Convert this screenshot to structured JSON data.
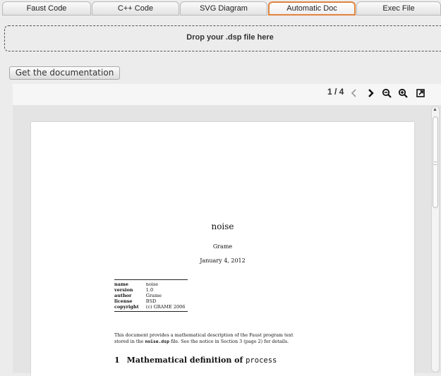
{
  "tabs": [
    {
      "label": "Faust Code",
      "active": false
    },
    {
      "label": "C++ Code",
      "active": false
    },
    {
      "label": "SVG Diagram",
      "active": false
    },
    {
      "label": "Automatic Doc",
      "active": true
    },
    {
      "label": "Exec File",
      "active": false
    }
  ],
  "dropzone": {
    "text": "Drop your .dsp file here"
  },
  "get_doc_button": "Get the documentation",
  "viewer": {
    "page_indicator": "1 / 4",
    "tools": {
      "prev": "chevron-left-icon",
      "next": "chevron-right-icon",
      "zoom_out": "zoom-out-icon",
      "zoom_in": "zoom-in-icon",
      "open": "external-open-icon"
    }
  },
  "document": {
    "title": "noise",
    "author": "Grame",
    "date": "January 4, 2012",
    "metadata": [
      {
        "key": "name",
        "value": "noise"
      },
      {
        "key": "version",
        "value": "1.0"
      },
      {
        "key": "author",
        "value": "Grame"
      },
      {
        "key": "license",
        "value": "BSD"
      },
      {
        "key": "copyright",
        "value": "(c) GRAME 2006"
      }
    ],
    "abstract_line1": "This document provides a mathematical description of the Faust program text",
    "abstract_line2_pre": "stored in the ",
    "abstract_file": "noise.dsp",
    "abstract_line2_post": " file. See the notice in Section 3 (page 2) for details.",
    "section_number": "1",
    "section_title": "Mathematical definition of",
    "section_code": "process"
  },
  "colors": {
    "active_tab_border": "#e0833d"
  }
}
